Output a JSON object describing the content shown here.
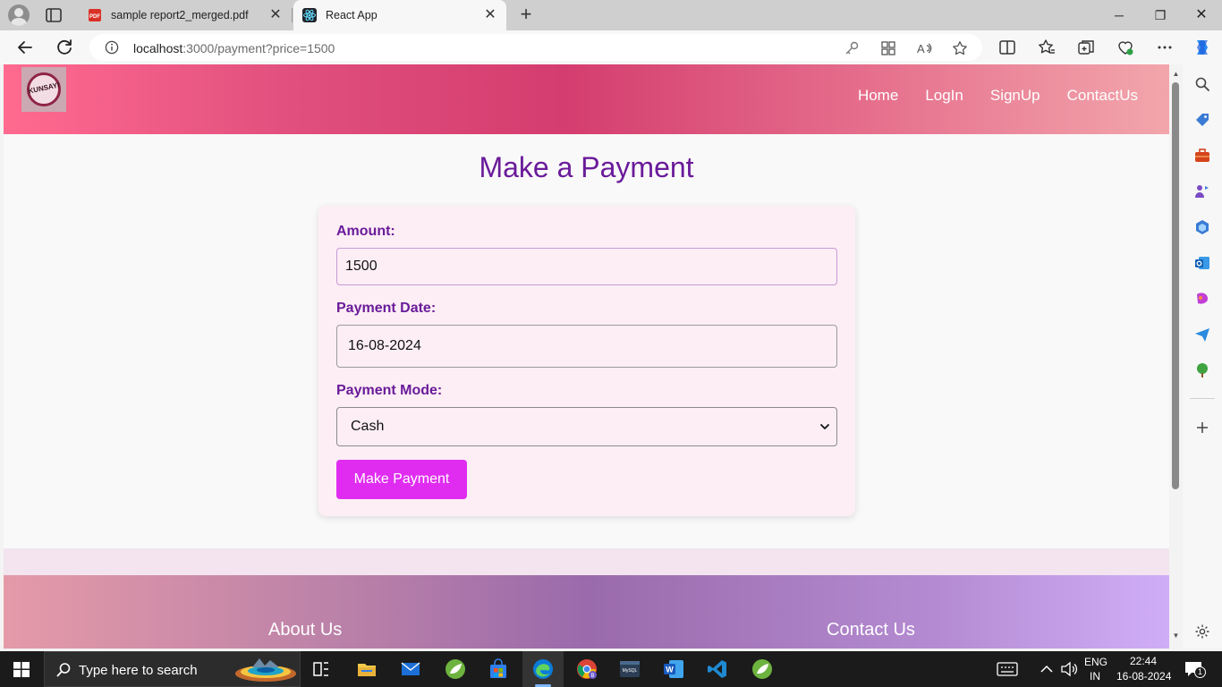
{
  "browser": {
    "tabs": [
      {
        "title": "sample report2_merged.pdf",
        "icon": "pdf-icon",
        "active": false
      },
      {
        "title": "React App",
        "icon": "react-icon",
        "active": true
      }
    ],
    "close_glyph": "✕",
    "new_tab_glyph": "+",
    "url_host": "localhost",
    "url_rest": ":3000/payment?price=1500",
    "window": {
      "minimize": "─",
      "maximize": "❐",
      "close": "✕"
    }
  },
  "site": {
    "logo_text": "KUNSAYI",
    "nav": {
      "home": "Home",
      "login": "LogIn",
      "signup": "SignUp",
      "contact": "ContactUs"
    },
    "page_title": "Make a Payment",
    "form": {
      "amount_label": "Amount:",
      "amount_value": "1500",
      "date_label": "Payment Date:",
      "date_value": "16-08-2024",
      "mode_label": "Payment Mode:",
      "mode_value": "Cash",
      "submit_label": "Make Payment"
    },
    "footer": {
      "about": "About Us",
      "contact": "Contact Us"
    },
    "colors": {
      "heading": "#6a1b9a",
      "button": "#e02cf0",
      "card": "#fdeef5"
    }
  },
  "taskbar": {
    "search_placeholder": "Type here to search",
    "lang_top": "ENG",
    "lang_bottom": "IN",
    "time": "22:44",
    "date": "16-08-2024",
    "notification_count": "1"
  }
}
